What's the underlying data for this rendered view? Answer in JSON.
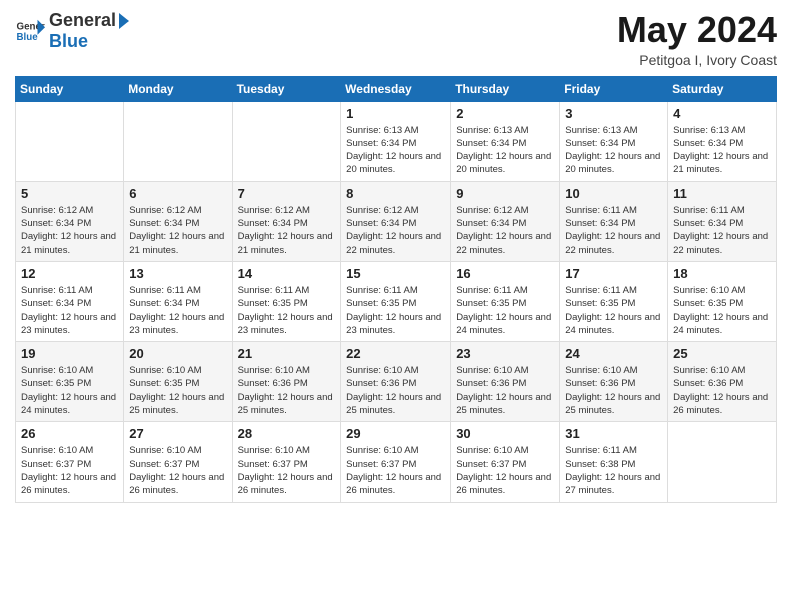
{
  "header": {
    "logo": {
      "general": "General",
      "blue": "Blue"
    },
    "title": "May 2024",
    "location": "Petitgoa I, Ivory Coast"
  },
  "weekdays": [
    "Sunday",
    "Monday",
    "Tuesday",
    "Wednesday",
    "Thursday",
    "Friday",
    "Saturday"
  ],
  "weeks": [
    [
      {
        "day": "",
        "sunrise": "",
        "sunset": "",
        "daylight": ""
      },
      {
        "day": "",
        "sunrise": "",
        "sunset": "",
        "daylight": ""
      },
      {
        "day": "",
        "sunrise": "",
        "sunset": "",
        "daylight": ""
      },
      {
        "day": "1",
        "sunrise": "Sunrise: 6:13 AM",
        "sunset": "Sunset: 6:34 PM",
        "daylight": "Daylight: 12 hours and 20 minutes."
      },
      {
        "day": "2",
        "sunrise": "Sunrise: 6:13 AM",
        "sunset": "Sunset: 6:34 PM",
        "daylight": "Daylight: 12 hours and 20 minutes."
      },
      {
        "day": "3",
        "sunrise": "Sunrise: 6:13 AM",
        "sunset": "Sunset: 6:34 PM",
        "daylight": "Daylight: 12 hours and 20 minutes."
      },
      {
        "day": "4",
        "sunrise": "Sunrise: 6:13 AM",
        "sunset": "Sunset: 6:34 PM",
        "daylight": "Daylight: 12 hours and 21 minutes."
      }
    ],
    [
      {
        "day": "5",
        "sunrise": "Sunrise: 6:12 AM",
        "sunset": "Sunset: 6:34 PM",
        "daylight": "Daylight: 12 hours and 21 minutes."
      },
      {
        "day": "6",
        "sunrise": "Sunrise: 6:12 AM",
        "sunset": "Sunset: 6:34 PM",
        "daylight": "Daylight: 12 hours and 21 minutes."
      },
      {
        "day": "7",
        "sunrise": "Sunrise: 6:12 AM",
        "sunset": "Sunset: 6:34 PM",
        "daylight": "Daylight: 12 hours and 21 minutes."
      },
      {
        "day": "8",
        "sunrise": "Sunrise: 6:12 AM",
        "sunset": "Sunset: 6:34 PM",
        "daylight": "Daylight: 12 hours and 22 minutes."
      },
      {
        "day": "9",
        "sunrise": "Sunrise: 6:12 AM",
        "sunset": "Sunset: 6:34 PM",
        "daylight": "Daylight: 12 hours and 22 minutes."
      },
      {
        "day": "10",
        "sunrise": "Sunrise: 6:11 AM",
        "sunset": "Sunset: 6:34 PM",
        "daylight": "Daylight: 12 hours and 22 minutes."
      },
      {
        "day": "11",
        "sunrise": "Sunrise: 6:11 AM",
        "sunset": "Sunset: 6:34 PM",
        "daylight": "Daylight: 12 hours and 22 minutes."
      }
    ],
    [
      {
        "day": "12",
        "sunrise": "Sunrise: 6:11 AM",
        "sunset": "Sunset: 6:34 PM",
        "daylight": "Daylight: 12 hours and 23 minutes."
      },
      {
        "day": "13",
        "sunrise": "Sunrise: 6:11 AM",
        "sunset": "Sunset: 6:34 PM",
        "daylight": "Daylight: 12 hours and 23 minutes."
      },
      {
        "day": "14",
        "sunrise": "Sunrise: 6:11 AM",
        "sunset": "Sunset: 6:35 PM",
        "daylight": "Daylight: 12 hours and 23 minutes."
      },
      {
        "day": "15",
        "sunrise": "Sunrise: 6:11 AM",
        "sunset": "Sunset: 6:35 PM",
        "daylight": "Daylight: 12 hours and 23 minutes."
      },
      {
        "day": "16",
        "sunrise": "Sunrise: 6:11 AM",
        "sunset": "Sunset: 6:35 PM",
        "daylight": "Daylight: 12 hours and 24 minutes."
      },
      {
        "day": "17",
        "sunrise": "Sunrise: 6:11 AM",
        "sunset": "Sunset: 6:35 PM",
        "daylight": "Daylight: 12 hours and 24 minutes."
      },
      {
        "day": "18",
        "sunrise": "Sunrise: 6:10 AM",
        "sunset": "Sunset: 6:35 PM",
        "daylight": "Daylight: 12 hours and 24 minutes."
      }
    ],
    [
      {
        "day": "19",
        "sunrise": "Sunrise: 6:10 AM",
        "sunset": "Sunset: 6:35 PM",
        "daylight": "Daylight: 12 hours and 24 minutes."
      },
      {
        "day": "20",
        "sunrise": "Sunrise: 6:10 AM",
        "sunset": "Sunset: 6:35 PM",
        "daylight": "Daylight: 12 hours and 25 minutes."
      },
      {
        "day": "21",
        "sunrise": "Sunrise: 6:10 AM",
        "sunset": "Sunset: 6:36 PM",
        "daylight": "Daylight: 12 hours and 25 minutes."
      },
      {
        "day": "22",
        "sunrise": "Sunrise: 6:10 AM",
        "sunset": "Sunset: 6:36 PM",
        "daylight": "Daylight: 12 hours and 25 minutes."
      },
      {
        "day": "23",
        "sunrise": "Sunrise: 6:10 AM",
        "sunset": "Sunset: 6:36 PM",
        "daylight": "Daylight: 12 hours and 25 minutes."
      },
      {
        "day": "24",
        "sunrise": "Sunrise: 6:10 AM",
        "sunset": "Sunset: 6:36 PM",
        "daylight": "Daylight: 12 hours and 25 minutes."
      },
      {
        "day": "25",
        "sunrise": "Sunrise: 6:10 AM",
        "sunset": "Sunset: 6:36 PM",
        "daylight": "Daylight: 12 hours and 26 minutes."
      }
    ],
    [
      {
        "day": "26",
        "sunrise": "Sunrise: 6:10 AM",
        "sunset": "Sunset: 6:37 PM",
        "daylight": "Daylight: 12 hours and 26 minutes."
      },
      {
        "day": "27",
        "sunrise": "Sunrise: 6:10 AM",
        "sunset": "Sunset: 6:37 PM",
        "daylight": "Daylight: 12 hours and 26 minutes."
      },
      {
        "day": "28",
        "sunrise": "Sunrise: 6:10 AM",
        "sunset": "Sunset: 6:37 PM",
        "daylight": "Daylight: 12 hours and 26 minutes."
      },
      {
        "day": "29",
        "sunrise": "Sunrise: 6:10 AM",
        "sunset": "Sunset: 6:37 PM",
        "daylight": "Daylight: 12 hours and 26 minutes."
      },
      {
        "day": "30",
        "sunrise": "Sunrise: 6:10 AM",
        "sunset": "Sunset: 6:37 PM",
        "daylight": "Daylight: 12 hours and 26 minutes."
      },
      {
        "day": "31",
        "sunrise": "Sunrise: 6:11 AM",
        "sunset": "Sunset: 6:38 PM",
        "daylight": "Daylight: 12 hours and 27 minutes."
      },
      {
        "day": "",
        "sunrise": "",
        "sunset": "",
        "daylight": ""
      }
    ]
  ]
}
